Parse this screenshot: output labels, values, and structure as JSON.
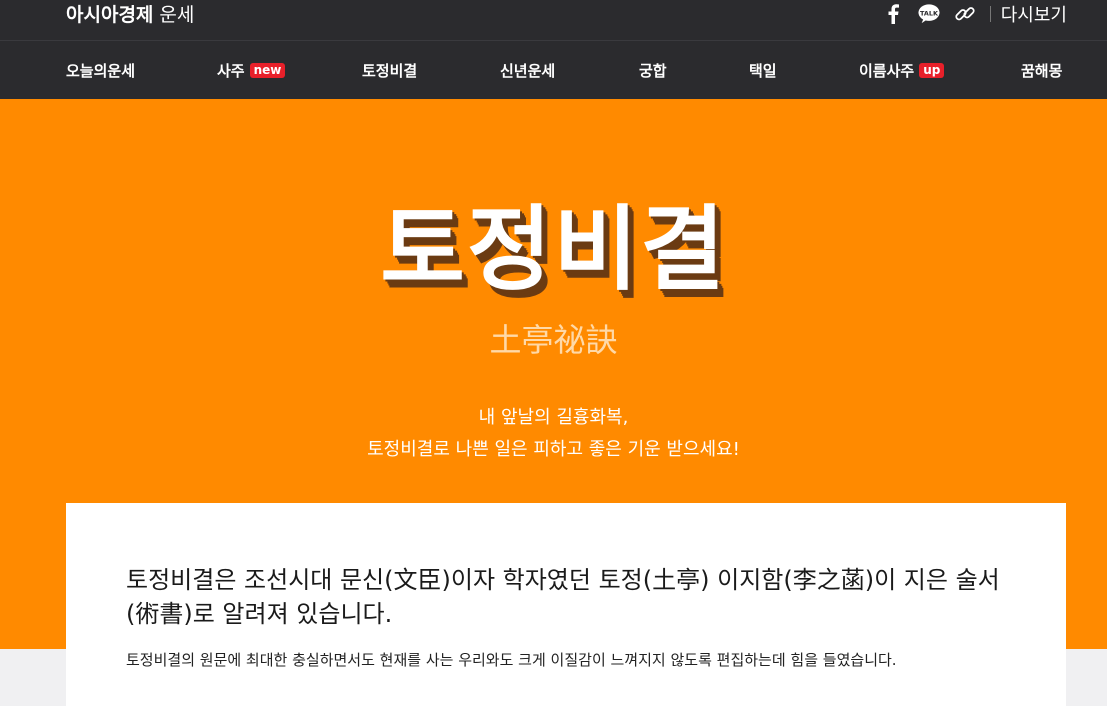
{
  "header": {
    "brand_bold": "아시아경제",
    "brand_light": "운세",
    "share_icons": [
      "facebook-icon",
      "kakaotalk-icon",
      "link-icon"
    ],
    "replay_label": "다시보기"
  },
  "nav": {
    "items": [
      {
        "label": "오늘의운세"
      },
      {
        "label": "사주",
        "badge": "new"
      },
      {
        "label": "토정비결"
      },
      {
        "label": "신년운세"
      },
      {
        "label": "궁합"
      },
      {
        "label": "택일"
      },
      {
        "label": "이름사주",
        "badge": "up"
      },
      {
        "label": "꿈해몽"
      }
    ],
    "badge_color": "#e8202a"
  },
  "hero": {
    "title": "토정비결",
    "hanja": "土亭祕訣",
    "desc_line1": "내 앞날의 길흉화복,",
    "desc_line2": "토정비결로 나쁜 일은 피하고 좋은 기운 받으세요!",
    "bg_color": "#ff8a00"
  },
  "intro": {
    "main": "토정비결은 조선시대 문신(文臣)이자 학자였던 토정(土亭) 이지함(李之菡)이 지은 술서(術書)로 알려져 있습니다.",
    "sub": "토정비결의 원문에 최대한 충실하면서도 현재를 사는 우리와도 크게 이질감이 느껴지지 않도록 편집하는데 힘을 들였습니다."
  }
}
